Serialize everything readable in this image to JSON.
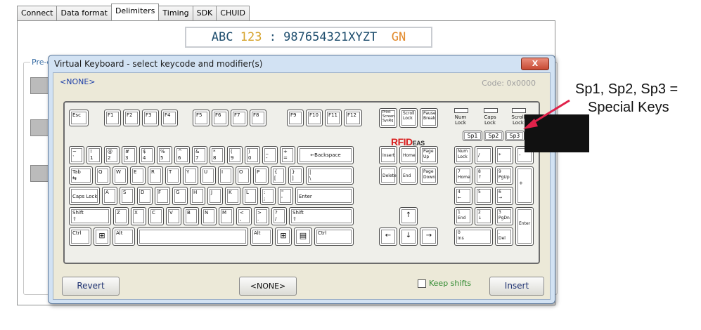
{
  "tabs": [
    "Connect",
    "Data format",
    "Delimiters",
    "Timing",
    "SDK",
    "CHUID"
  ],
  "active_tab": "Delimiters",
  "sample_output": {
    "part1": "ABC ",
    "part2": "123",
    "part3": " : 987654321XYZT ",
    "part4": " GN"
  },
  "predefined_label": "Pre-de",
  "dialog": {
    "title": "Virtual Keyboard - select keycode and modifier(s)",
    "close_label": "X",
    "selected_key": "<NONE>",
    "code_label": "Code: 0x0000",
    "brand": "RFID",
    "brand_suffix": "EAS",
    "keys": {
      "esc": "Esc",
      "f1": "F1",
      "f2": "F2",
      "f3": "F3",
      "f4": "F4",
      "f5": "F5",
      "f6": "F6",
      "f7": "F7",
      "f8": "F8",
      "f9": "F9",
      "f10": "F10",
      "f11": "F11",
      "f12": "F12",
      "print": "Print\nScreen\nSysRq",
      "scroll": "Scroll\nLock",
      "pause": "Pause\nBreak",
      "led_num": "Num\nLock",
      "led_caps": "Caps\nLock",
      "led_scroll": "Scroll\nLock",
      "sp1": "Sp1",
      "sp2": "Sp2",
      "sp3": "Sp3",
      "tilde": "~\n`",
      "n1": "!\n1",
      "n2": "@\n2",
      "n3": "#\n3",
      "n4": "$\n4",
      "n5": "%\n5",
      "n6": "^\n6",
      "n7": "&\n7",
      "n8": "*\n8",
      "n9": "(\n9",
      "n0": ")\n0",
      "minus": "_\n-",
      "equals": "+\n=",
      "backspace": "←Backspace",
      "tab": "Tab\n⇆",
      "q": "Q",
      "w": "W",
      "e": "E",
      "r": "R",
      "t": "T",
      "y": "Y",
      "u": "U",
      "i": "I",
      "o": "O",
      "p": "P",
      "lbracket": "{\n[",
      "rbracket": "}\n]",
      "backslash": "|\n\\",
      "caps": "Caps Lock",
      "a": "A",
      "s": "S",
      "d": "D",
      "f": "F",
      "g": "G",
      "h": "H",
      "j": "J",
      "k": "K",
      "l": "L",
      "semicolon": ":\n;",
      "quote": "\"\n'",
      "enter": "Enter",
      "lshift": "Shift\n⇧",
      "z": "Z",
      "x": "X",
      "c": "C",
      "v": "V",
      "b": "B",
      "n": "N",
      "m": "M",
      "comma": "<\n,",
      "period": ">\n.",
      "slash": "?\n/",
      "rshift": "Shift\n⇧",
      "lctrl": "Ctrl",
      "lwin": "⊞",
      "lalt": "Alt",
      "space": "",
      "ralt": "Alt",
      "rwin": "⊞",
      "menu": "▤",
      "rctrl": "Ctrl",
      "insert": "Insert",
      "home": "Home",
      "pgup": "Page\nUp",
      "delete": "Delete",
      "end": "End",
      "pgdn": "Page\nDown",
      "up": "↑",
      "left": "←",
      "down": "↓",
      "right": "→",
      "numlock": "Num\nLock",
      "kpdiv": "/",
      "kpmul": "*",
      "kpminus": "-",
      "kp7": "7\nHome",
      "kp8": "8\n↑",
      "kp9": "9\nPgUp",
      "kpplus": "+",
      "kp4": "4\n←",
      "kp5": "5",
      "kp6": "6\n→",
      "kp1": "1\nEnd",
      "kp2": "2\n↓",
      "kp3": "3\nPgDn",
      "kpenter": "Enter",
      "kp0": "0\nIns",
      "kpdot": ".\nDel"
    },
    "revert_label": "Revert",
    "none_label": "<NONE>",
    "keep_shifts_label": "Keep shifts",
    "insert_label": "Insert"
  },
  "annotation": {
    "line1": "Sp1, Sp2, Sp3 =",
    "line2": "Special Keys"
  },
  "colors": {
    "arrow": "#e0224a",
    "brand": "#d91f1f"
  }
}
